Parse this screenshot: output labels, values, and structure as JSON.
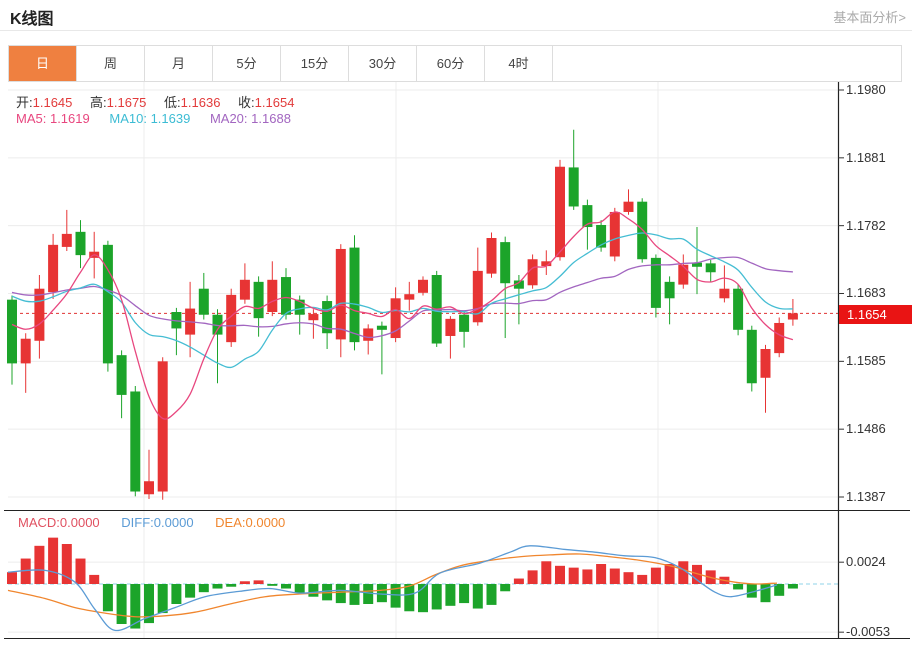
{
  "header": {
    "title": "K线图",
    "link": "基本面分析>"
  },
  "tabs": [
    {
      "id": "day",
      "label": "日",
      "active": true
    },
    {
      "id": "week",
      "label": "周",
      "active": false
    },
    {
      "id": "month",
      "label": "月",
      "active": false
    },
    {
      "id": "5min",
      "label": "5分",
      "active": false
    },
    {
      "id": "15min",
      "label": "15分",
      "active": false
    },
    {
      "id": "30min",
      "label": "30分",
      "active": false
    },
    {
      "id": "60min",
      "label": "60分",
      "active": false
    },
    {
      "id": "4hour",
      "label": "4时",
      "active": false
    }
  ],
  "ohlc_bar": {
    "open_label": "开:",
    "open": "1.1645",
    "high_label": "高:",
    "high": "1.1675",
    "low_label": "低:",
    "low": "1.1636",
    "close_label": "收:",
    "close": "1.1654"
  },
  "ma_bar": {
    "ma5_label": "MA5:",
    "ma5": "1.1619",
    "ma10_label": "MA10:",
    "ma10": "1.1639",
    "ma20_label": "MA20:",
    "ma20": "1.1688"
  },
  "macd_bar": {
    "macd_label": "MACD:",
    "macd": "0.0000",
    "diff_label": "DIFF:",
    "diff": "0.0000",
    "dea_label": "DEA:",
    "dea": "0.0000"
  },
  "price_tag": "1.1654",
  "colors": {
    "up": "#e73434",
    "down": "#1ca42a",
    "ma5": "#e8477f",
    "ma10": "#45bdd3",
    "ma20": "#a266c0",
    "diff": "#5b9bd5",
    "dea": "#f0862e",
    "tab_accent": "#ef8040",
    "price_line": "#e03333",
    "price_tag_bg": "#e91414",
    "zero_line": "#8fd3e8",
    "grid": "#ececec",
    "frame": "#222222"
  },
  "chart_data": [
    {
      "type": "candlestick",
      "title": "K线图",
      "y_axis_labels": [
        "1.1980",
        "1.1881",
        "1.1782",
        "1.1683",
        "1.1585",
        "1.1486",
        "1.1387"
      ],
      "current_price": 1.1654,
      "legend": [
        "MA5",
        "MA10",
        "MA20"
      ],
      "ma_seeds": {
        "ma5": 1.1652,
        "ma10": 1.169,
        "ma20": 1.169
      },
      "candles": [
        [
          1.1674,
          1.168,
          1.155,
          1.1581
        ],
        [
          1.1581,
          1.1625,
          1.1538,
          1.1617
        ],
        [
          1.1614,
          1.171,
          1.1588,
          1.169
        ],
        [
          1.1685,
          1.177,
          1.1675,
          1.1754
        ],
        [
          1.1751,
          1.1805,
          1.1745,
          1.177
        ],
        [
          1.1773,
          1.179,
          1.172,
          1.1739
        ],
        [
          1.1735,
          1.1773,
          1.1705,
          1.1744
        ],
        [
          1.1754,
          1.176,
          1.1569,
          1.1581
        ],
        [
          1.1593,
          1.16,
          1.1501,
          1.1535
        ],
        [
          1.154,
          1.1548,
          1.1387,
          1.1394
        ],
        [
          1.139,
          1.1455,
          1.1383,
          1.1409
        ],
        [
          1.1394,
          1.159,
          1.1382,
          1.1584
        ],
        [
          1.1656,
          1.1662,
          1.1593,
          1.1632
        ],
        [
          1.1623,
          1.17,
          1.159,
          1.1661
        ],
        [
          1.169,
          1.1713,
          1.1645,
          1.1652
        ],
        [
          1.1652,
          1.166,
          1.1552,
          1.1623
        ],
        [
          1.1612,
          1.169,
          1.1605,
          1.1681
        ],
        [
          1.1674,
          1.1727,
          1.1668,
          1.1703
        ],
        [
          1.17,
          1.1708,
          1.162,
          1.1647
        ],
        [
          1.1656,
          1.173,
          1.165,
          1.1703
        ],
        [
          1.1707,
          1.172,
          1.1645,
          1.1652
        ],
        [
          1.1674,
          1.168,
          1.1623,
          1.1652
        ],
        [
          1.1644,
          1.166,
          1.1617,
          1.1653
        ],
        [
          1.1672,
          1.168,
          1.1602,
          1.1625
        ],
        [
          1.1616,
          1.1755,
          1.159,
          1.1748
        ],
        [
          1.175,
          1.1768,
          1.16,
          1.1612
        ],
        [
          1.1614,
          1.1638,
          1.1594,
          1.1632
        ],
        [
          1.1636,
          1.1642,
          1.1565,
          1.163
        ],
        [
          1.1618,
          1.1692,
          1.1612,
          1.1676
        ],
        [
          1.1674,
          1.17,
          1.1658,
          1.1682
        ],
        [
          1.1684,
          1.1708,
          1.168,
          1.1703
        ],
        [
          1.171,
          1.1716,
          1.1605,
          1.161
        ],
        [
          1.1621,
          1.165,
          1.1588,
          1.1646
        ],
        [
          1.1652,
          1.1656,
          1.1604,
          1.1627
        ],
        [
          1.1641,
          1.175,
          1.1636,
          1.1716
        ],
        [
          1.1712,
          1.1772,
          1.1706,
          1.1764
        ],
        [
          1.1758,
          1.1766,
          1.1618,
          1.1698
        ],
        [
          1.1702,
          1.171,
          1.1638,
          1.169
        ],
        [
          1.1695,
          1.174,
          1.169,
          1.1733
        ],
        [
          1.1723,
          1.1746,
          1.171,
          1.173
        ],
        [
          1.1736,
          1.1878,
          1.1731,
          1.1868
        ],
        [
          1.1867,
          1.1922,
          1.1805,
          1.181
        ],
        [
          1.1812,
          1.182,
          1.1747,
          1.178
        ],
        [
          1.1783,
          1.179,
          1.1744,
          1.175
        ],
        [
          1.1737,
          1.1808,
          1.173,
          1.1802
        ],
        [
          1.1802,
          1.1835,
          1.1798,
          1.1817
        ],
        [
          1.1817,
          1.1822,
          1.1728,
          1.1733
        ],
        [
          1.1735,
          1.174,
          1.1648,
          1.1662
        ],
        [
          1.17,
          1.1708,
          1.1638,
          1.1676
        ],
        [
          1.1696,
          1.174,
          1.169,
          1.1725
        ],
        [
          1.1728,
          1.178,
          1.1682,
          1.1722
        ],
        [
          1.1727,
          1.1732,
          1.17,
          1.1714
        ],
        [
          1.1676,
          1.1724,
          1.167,
          1.169
        ],
        [
          1.169,
          1.1696,
          1.1622,
          1.163
        ],
        [
          1.163,
          1.1636,
          1.154,
          1.1552
        ],
        [
          1.156,
          1.1608,
          1.1509,
          1.1602
        ],
        [
          1.1596,
          1.1648,
          1.159,
          1.164
        ],
        [
          1.1645,
          1.1675,
          1.1636,
          1.1654
        ]
      ]
    },
    {
      "type": "bar",
      "name": "MACD",
      "y_axis_labels": [
        "0.0024",
        "-0.0053"
      ],
      "histogram": [
        0.0013,
        0.0028,
        0.0042,
        0.0051,
        0.0044,
        0.0028,
        0.001,
        -0.003,
        -0.0044,
        -0.0049,
        -0.0043,
        -0.0032,
        -0.0022,
        -0.0015,
        -0.0009,
        -0.0005,
        -0.0003,
        0.0003,
        0.0004,
        -0.0002,
        -0.0005,
        -0.001,
        -0.0014,
        -0.0018,
        -0.0021,
        -0.0023,
        -0.0022,
        -0.002,
        -0.0026,
        -0.003,
        -0.0031,
        -0.0028,
        -0.0024,
        -0.0021,
        -0.0027,
        -0.0023,
        -0.0008,
        0.0006,
        0.0015,
        0.0025,
        0.002,
        0.0018,
        0.0016,
        0.0022,
        0.0017,
        0.0013,
        0.001,
        0.0018,
        0.0022,
        0.0025,
        0.0021,
        0.0015,
        0.0008,
        -0.0006,
        -0.0015,
        -0.002,
        -0.0013,
        -0.0005
      ],
      "diff_points": [
        [
          8,
          0.0013
        ],
        [
          45,
          0.0015
        ],
        [
          75,
          0.0002
        ],
        [
          95,
          -0.0028
        ],
        [
          115,
          -0.0051
        ],
        [
          145,
          -0.0038
        ],
        [
          175,
          -0.0026
        ],
        [
          205,
          -0.0014
        ],
        [
          240,
          -0.0008
        ],
        [
          270,
          -0.0005
        ],
        [
          300,
          -0.001
        ],
        [
          340,
          -0.0007
        ],
        [
          380,
          -0.0011
        ],
        [
          415,
          -0.001
        ],
        [
          440,
          0.0012
        ],
        [
          480,
          0.0023
        ],
        [
          510,
          0.0035
        ],
        [
          530,
          0.0042
        ],
        [
          565,
          0.0038
        ],
        [
          595,
          0.0035
        ],
        [
          625,
          0.0031
        ],
        [
          655,
          0.0029
        ],
        [
          680,
          0.0018
        ],
        [
          700,
          0.0002
        ],
        [
          715,
          -0.0009
        ],
        [
          730,
          -0.0014
        ],
        [
          752,
          -0.0009
        ],
        [
          777,
          -0.0001
        ]
      ],
      "dea_points": [
        [
          8,
          -0.0007
        ],
        [
          45,
          -0.0016
        ],
        [
          75,
          -0.0026
        ],
        [
          105,
          -0.0032
        ],
        [
          135,
          -0.0036
        ],
        [
          165,
          -0.0035
        ],
        [
          195,
          -0.0031
        ],
        [
          230,
          -0.0022
        ],
        [
          265,
          -0.0014
        ],
        [
          300,
          -0.0011
        ],
        [
          340,
          -0.0009
        ],
        [
          380,
          -0.0007
        ],
        [
          410,
          -0.0002
        ],
        [
          435,
          0.001
        ],
        [
          460,
          0.002
        ],
        [
          490,
          0.0026
        ],
        [
          520,
          0.003
        ],
        [
          550,
          0.0032
        ],
        [
          580,
          0.0033
        ],
        [
          610,
          0.003
        ],
        [
          640,
          0.0026
        ],
        [
          670,
          0.002
        ],
        [
          695,
          0.0012
        ],
        [
          715,
          0.0006
        ],
        [
          735,
          0.0002
        ],
        [
          755,
          0.0
        ],
        [
          777,
          0.0001
        ]
      ]
    }
  ]
}
